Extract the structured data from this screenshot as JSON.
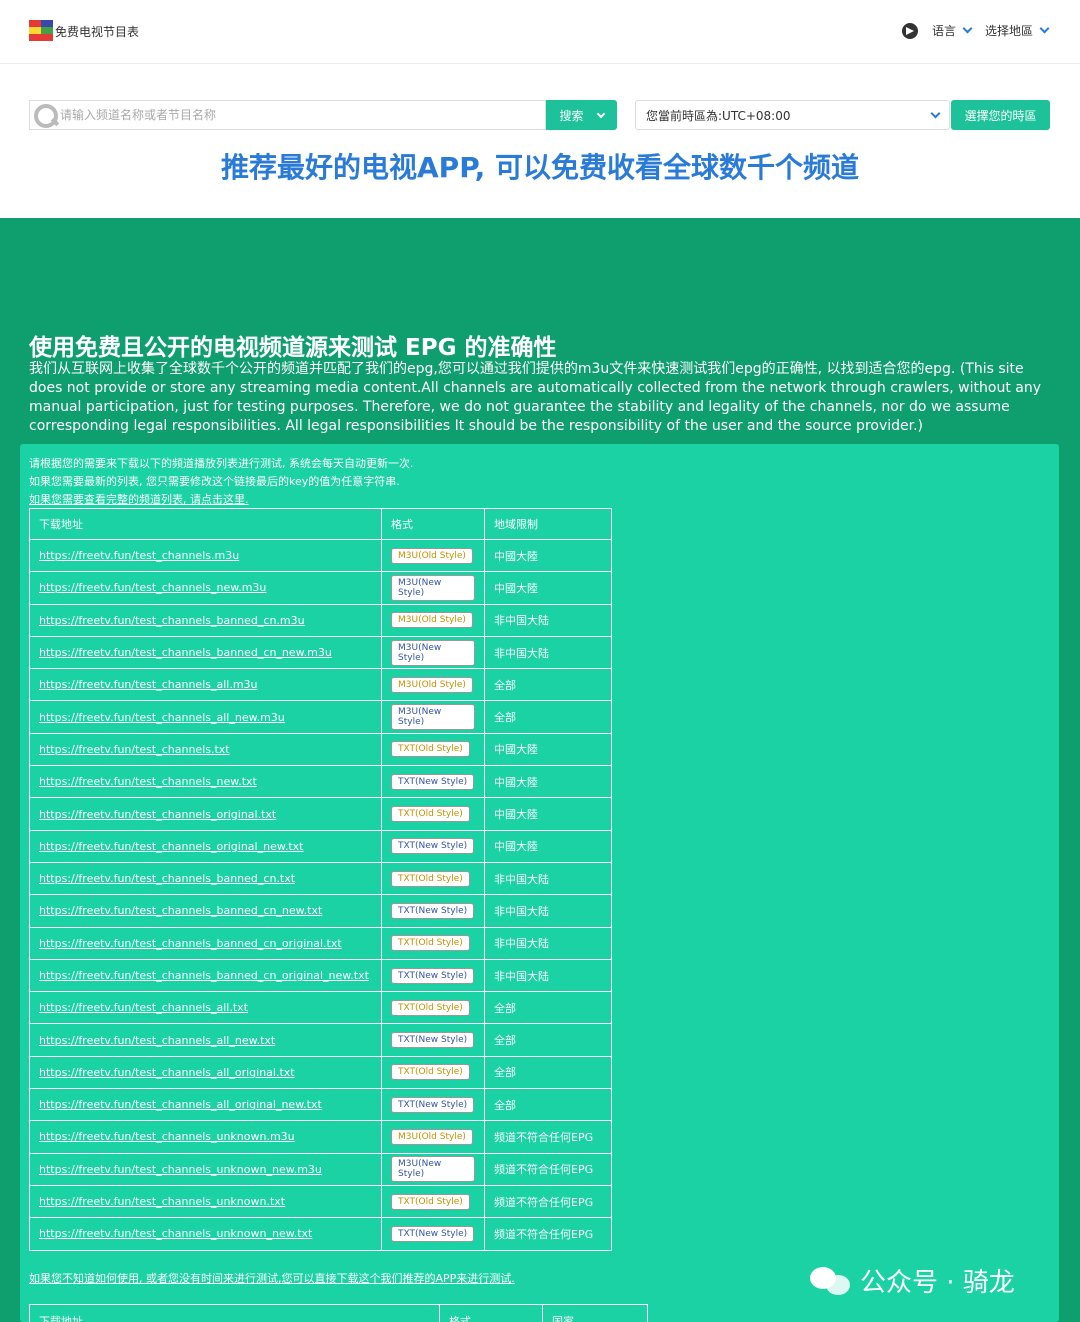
{
  "header": {
    "site_title": "免费电视节目表",
    "language_label": "语言",
    "region_label": "选择地區"
  },
  "search": {
    "placeholder": "请输入频道名称或者节目名称",
    "button_label": "搜索",
    "timezone_label": "您當前時區為:UTC+08:00",
    "timezone_button": "選擇您的時區"
  },
  "promo": "推荐最好的电视APP, 可以免费收看全球数千个频道",
  "hero": {
    "title": "使用免费且公开的电视频道源来测试 EPG 的准确性",
    "description": "我们从互联网上收集了全球数千个公开的频道并匹配了我们的epg,您可以通过我们提供的m3u文件来快速测试我们epg的正确性, 以找到适合您的epg. (This site does not provide or store any streaming media content.All channels are automatically collected from the network through crawlers, without any manual participation, just for testing purposes. Therefore, we do not guarantee the stability and legality of the channels, nor do we assume corresponding legal responsibilities. All legal responsibilities It should be the responsibility of the user and the source provider.)"
  },
  "notes": {
    "line1": "请根据您的需要来下载以下的频道播放列表进行测试, 系统会每天自动更新一次.",
    "line2": "如果您需要最新的列表, 您只需要修改这个链接最后的key的值为任意字符串.",
    "link": "如果您需要查看完整的频道列表, 请点击这里."
  },
  "table": {
    "headers": [
      "下载地址",
      "格式",
      "地域限制"
    ],
    "rows": [
      {
        "url": "https://freetv.fun/test_channels.m3u",
        "format": "M3U(Old Style)",
        "style": "old",
        "region": "中國大陸"
      },
      {
        "url": "https://freetv.fun/test_channels_new.m3u",
        "format": "M3U(New Style)",
        "style": "new",
        "region": "中國大陸"
      },
      {
        "url": "https://freetv.fun/test_channels_banned_cn.m3u",
        "format": "M3U(Old Style)",
        "style": "old",
        "region": "非中国大陆"
      },
      {
        "url": "https://freetv.fun/test_channels_banned_cn_new.m3u",
        "format": "M3U(New Style)",
        "style": "new",
        "region": "非中国大陆"
      },
      {
        "url": "https://freetv.fun/test_channels_all.m3u",
        "format": "M3U(Old Style)",
        "style": "old",
        "region": "全部"
      },
      {
        "url": "https://freetv.fun/test_channels_all_new.m3u",
        "format": "M3U(New Style)",
        "style": "new",
        "region": "全部"
      },
      {
        "url": "https://freetv.fun/test_channels.txt",
        "format": "TXT(Old Style)",
        "style": "old",
        "region": "中國大陸"
      },
      {
        "url": "https://freetv.fun/test_channels_new.txt",
        "format": "TXT(New Style)",
        "style": "new",
        "region": "中國大陸"
      },
      {
        "url": "https://freetv.fun/test_channels_original.txt",
        "format": "TXT(Old Style)",
        "style": "old",
        "region": "中國大陸"
      },
      {
        "url": "https://freetv.fun/test_channels_original_new.txt",
        "format": "TXT(New Style)",
        "style": "new",
        "region": "中國大陸"
      },
      {
        "url": "https://freetv.fun/test_channels_banned_cn.txt",
        "format": "TXT(Old Style)",
        "style": "old",
        "region": "非中国大陆"
      },
      {
        "url": "https://freetv.fun/test_channels_banned_cn_new.txt",
        "format": "TXT(New Style)",
        "style": "new",
        "region": "非中国大陆"
      },
      {
        "url": "https://freetv.fun/test_channels_banned_cn_original.txt",
        "format": "TXT(Old Style)",
        "style": "old",
        "region": "非中国大陆"
      },
      {
        "url": "https://freetv.fun/test_channels_banned_cn_original_new.txt",
        "format": "TXT(New Style)",
        "style": "new",
        "region": "非中国大陆"
      },
      {
        "url": "https://freetv.fun/test_channels_all.txt",
        "format": "TXT(Old Style)",
        "style": "old",
        "region": "全部"
      },
      {
        "url": "https://freetv.fun/test_channels_all_new.txt",
        "format": "TXT(New Style)",
        "style": "new",
        "region": "全部"
      },
      {
        "url": "https://freetv.fun/test_channels_all_original.txt",
        "format": "TXT(Old Style)",
        "style": "old",
        "region": "全部"
      },
      {
        "url": "https://freetv.fun/test_channels_all_original_new.txt",
        "format": "TXT(New Style)",
        "style": "new",
        "region": "全部"
      },
      {
        "url": "https://freetv.fun/test_channels_unknown.m3u",
        "format": "M3U(Old Style)",
        "style": "old",
        "region": "频道不符合任何EPG"
      },
      {
        "url": "https://freetv.fun/test_channels_unknown_new.m3u",
        "format": "M3U(New Style)",
        "style": "new",
        "region": "频道不符合任何EPG"
      },
      {
        "url": "https://freetv.fun/test_channels_unknown.txt",
        "format": "TXT(Old Style)",
        "style": "old",
        "region": "频道不符合任何EPG"
      },
      {
        "url": "https://freetv.fun/test_channels_unknown_new.txt",
        "format": "TXT(New Style)",
        "style": "new",
        "region": "频道不符合任何EPG"
      }
    ]
  },
  "recommend_link": "如果您不知道如何使用, 或者您没有时间来进行测试,您可以直接下载这个我们推荐的APP来进行测试.",
  "table2": {
    "headers": [
      "下载地址",
      "格式",
      "国家"
    ]
  },
  "watermark": {
    "text": "公众号 · 骑龙"
  },
  "colors": {
    "accent": "#1ec29a",
    "green_bg": "#0f9f6e",
    "card_bg": "#1ad2a4",
    "promo": "#2a7bd8"
  }
}
